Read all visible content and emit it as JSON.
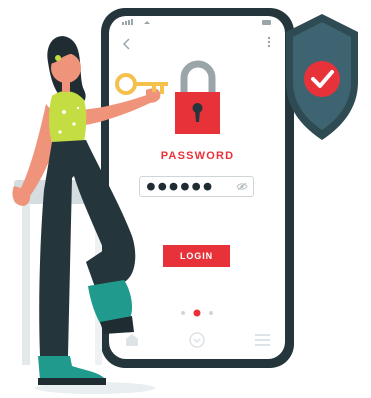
{
  "login_screen": {
    "heading": "PASSWORD",
    "password_mask": "●●●●●●",
    "login_label": "LOGIN"
  },
  "icons": {
    "back": "chevron-left-icon",
    "menu": "kebab-menu-icon",
    "eye": "eye-icon",
    "lock": "padlock-icon",
    "shield": "shield-check-icon",
    "key": "key-icon",
    "home": "home-icon",
    "circle": "circle-nav-icon",
    "hamburger": "hamburger-menu-icon"
  },
  "carousel": {
    "total": 3,
    "active": 2
  },
  "colors": {
    "accent_red": "#e8323a",
    "phone_frame": "#24353b",
    "shield_dark": "#2e4b54",
    "shield_light": "#3d6470",
    "skin": "#f0937b",
    "shirt": "#c4dd42",
    "pants": "#24353b",
    "shoes": "#1f9a8c",
    "key_gold": "#f3c14c"
  }
}
